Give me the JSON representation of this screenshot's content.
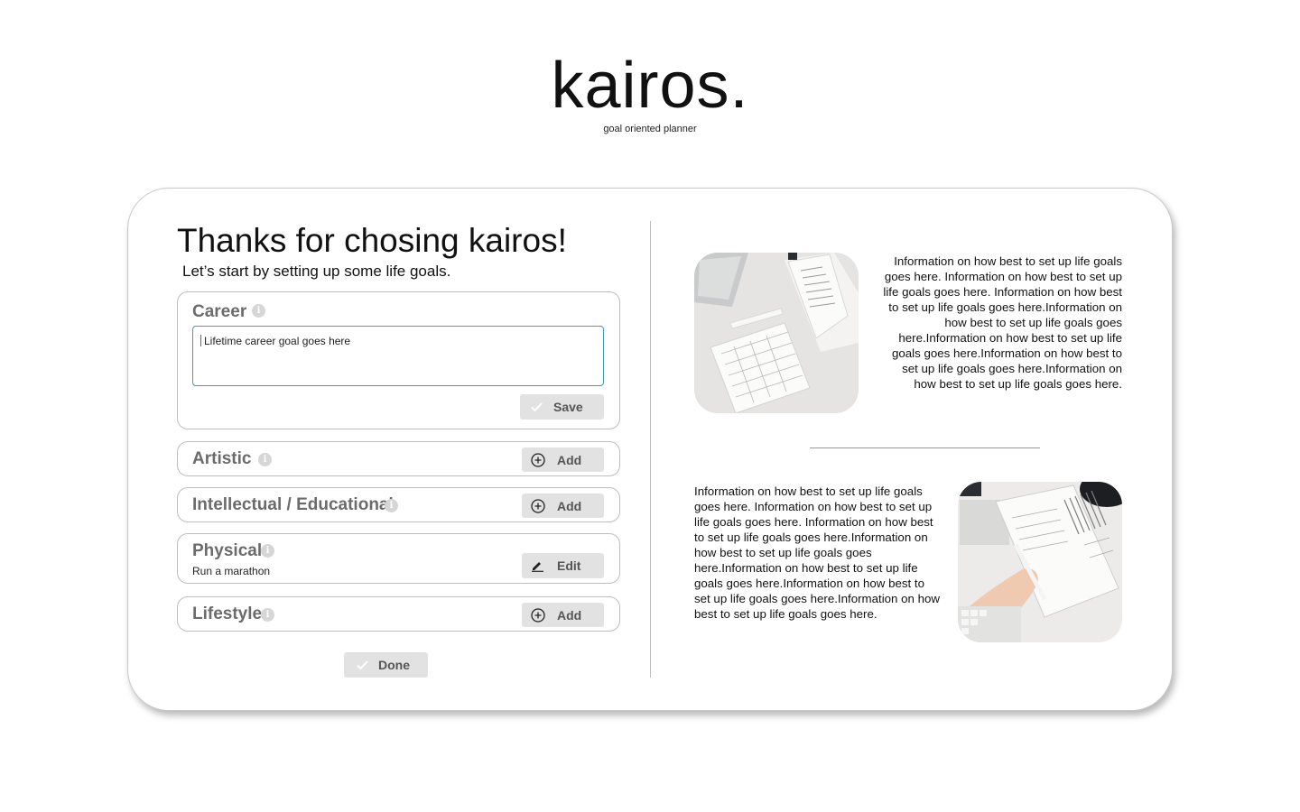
{
  "brand": {
    "logo": "kairos.",
    "tagline": "goal oriented planner"
  },
  "intro": {
    "heading": "Thanks for chosing kairos!",
    "subheading": "Let’s start by setting up some life goals."
  },
  "goals": {
    "career": {
      "title": "Career",
      "input_value": "Lifetime career goal goes here",
      "save_label": "Save"
    },
    "artistic": {
      "title": "Artistic",
      "action_label": "Add"
    },
    "intellectual": {
      "title": "Intellectual / Educational",
      "action_label": "Add"
    },
    "physical": {
      "title": "Physical",
      "value": "Run a marathon",
      "action_label": "Edit"
    },
    "lifestyle": {
      "title": "Lifestyle",
      "action_label": "Add"
    }
  },
  "done_label": "Done",
  "info": {
    "top_text": "Information on how best to set up life goals goes here. Information on how best to set up life goals goes here. Information on how best to set up life goals goes here.Information on how best to set up life goals goes here.Information on how best to set up life goals goes here.Information on how best to set up life goals goes here.Information on how best to set up life goals goes here.",
    "bottom_text": "Information on how best to set up life goals goes here. Information on how best to set up life goals goes here. Information on how best to set up life goals goes here.Information on how best to set up life goals goes here.Information on how best to set up life goals goes here.Information on how best to set up life goals goes here.Information on how best to set up life goals goes here."
  },
  "icons": {
    "info": "info-icon",
    "check": "check-icon",
    "add": "plus-circle-icon",
    "edit": "pencil-icon"
  },
  "colors": {
    "accent_border": "#3a9bd8",
    "button_bg": "#e2e2e2",
    "title_gray": "#6b6b6b"
  }
}
